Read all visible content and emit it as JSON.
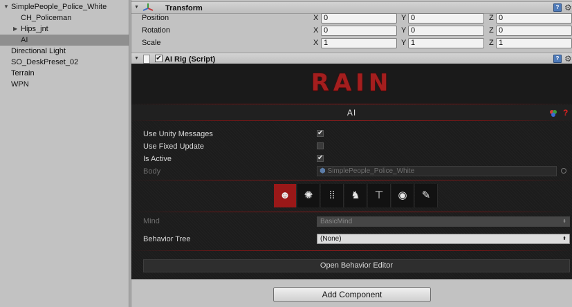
{
  "hierarchy": {
    "items": [
      {
        "label": "SimplePeople_Police_White",
        "indent": 0,
        "arrow": "▼"
      },
      {
        "label": "CH_Policeman",
        "indent": 1,
        "arrow": ""
      },
      {
        "label": "Hips_jnt",
        "indent": 1,
        "arrow": "▶"
      },
      {
        "label": "AI",
        "indent": 1,
        "arrow": "",
        "selected": true
      },
      {
        "label": "Directional Light",
        "indent": 0,
        "arrow": ""
      },
      {
        "label": "SO_DeskPreset_02",
        "indent": 0,
        "arrow": ""
      },
      {
        "label": "Terrain",
        "indent": 0,
        "arrow": ""
      },
      {
        "label": "WPN",
        "indent": 0,
        "arrow": ""
      }
    ]
  },
  "transform": {
    "title": "Transform",
    "rows": [
      {
        "label": "Position",
        "x": "0",
        "y": "0",
        "z": "0"
      },
      {
        "label": "Rotation",
        "x": "0",
        "y": "0",
        "z": "0"
      },
      {
        "label": "Scale",
        "x": "1",
        "y": "1",
        "z": "1"
      }
    ],
    "axis_x": "X",
    "axis_y": "Y",
    "axis_z": "Z"
  },
  "ai_rig": {
    "title": "AI Rig (Script)",
    "enabled": true
  },
  "rain": {
    "logo": "RAIN",
    "panel_title": "AI",
    "use_unity_messages_label": "Use Unity Messages",
    "use_unity_messages": true,
    "use_fixed_update_label": "Use Fixed Update",
    "use_fixed_update": false,
    "is_active_label": "Is Active",
    "is_active": true,
    "body_label": "Body",
    "body_value": "SimplePeople_Police_White",
    "tabs": [
      "head-icon",
      "lightbulb-icon",
      "footprints-icon",
      "runner-icon",
      "skeleton-icon",
      "eye-icon",
      "pencil-icon"
    ],
    "mind_label": "Mind",
    "mind_value": "BasicMind",
    "behavior_tree_label": "Behavior Tree",
    "behavior_tree_value": "(None)",
    "open_editor_label": "Open Behavior Editor"
  },
  "add_component_label": "Add Component",
  "colors": {
    "accent_red": "#9a1818",
    "logo_red": "#a41e1e",
    "panel_dark": "#1c1c1c",
    "selection": "#8f8f8f"
  }
}
